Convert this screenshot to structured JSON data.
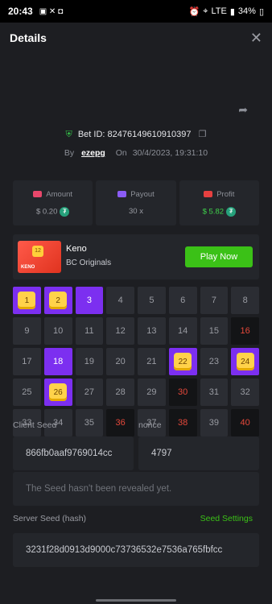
{
  "status_bar": {
    "time": "20:43",
    "signal": "LTE",
    "battery": "34%"
  },
  "header": {
    "title": "Details",
    "close": "✕"
  },
  "bet": {
    "id_label": "Bet ID:",
    "id": "82476149610910397",
    "by_label": "By",
    "user": "ezepg",
    "on_label": "On",
    "date": "30/4/2023, 19:31:10"
  },
  "stats": {
    "amount": {
      "label": "Amount",
      "value": "$ 0.20"
    },
    "payout": {
      "label": "Payout",
      "value": "30 x"
    },
    "profit": {
      "label": "Profit",
      "value": "$ 5.82"
    }
  },
  "game": {
    "name": "Keno",
    "provider": "BC Originals",
    "play_label": "Play Now",
    "thumb_caption": "KENO",
    "thumb_mini": "12"
  },
  "board": {
    "rows": [
      [
        {
          "n": "1",
          "s": "hit"
        },
        {
          "n": "2",
          "s": "hit"
        },
        {
          "n": "3",
          "s": "pick"
        },
        {
          "n": "4",
          "s": ""
        },
        {
          "n": "5",
          "s": ""
        },
        {
          "n": "6",
          "s": ""
        },
        {
          "n": "7",
          "s": ""
        },
        {
          "n": "8",
          "s": ""
        }
      ],
      [
        {
          "n": "9",
          "s": ""
        },
        {
          "n": "10",
          "s": ""
        },
        {
          "n": "11",
          "s": ""
        },
        {
          "n": "12",
          "s": ""
        },
        {
          "n": "13",
          "s": ""
        },
        {
          "n": "14",
          "s": ""
        },
        {
          "n": "15",
          "s": ""
        },
        {
          "n": "16",
          "s": "drawn"
        }
      ],
      [
        {
          "n": "17",
          "s": ""
        },
        {
          "n": "18",
          "s": "pick"
        },
        {
          "n": "19",
          "s": ""
        },
        {
          "n": "20",
          "s": ""
        },
        {
          "n": "21",
          "s": ""
        },
        {
          "n": "22",
          "s": "hit"
        },
        {
          "n": "23",
          "s": ""
        },
        {
          "n": "24",
          "s": "hit"
        }
      ],
      [
        {
          "n": "25",
          "s": ""
        },
        {
          "n": "26",
          "s": "hit"
        },
        {
          "n": "27",
          "s": ""
        },
        {
          "n": "28",
          "s": ""
        },
        {
          "n": "29",
          "s": ""
        },
        {
          "n": "30",
          "s": "drawn"
        },
        {
          "n": "31",
          "s": ""
        },
        {
          "n": "32",
          "s": ""
        }
      ],
      [
        {
          "n": "33",
          "s": ""
        },
        {
          "n": "34",
          "s": ""
        },
        {
          "n": "35",
          "s": ""
        },
        {
          "n": "36",
          "s": "drawn"
        },
        {
          "n": "37",
          "s": ""
        },
        {
          "n": "38",
          "s": "drawn"
        },
        {
          "n": "39",
          "s": ""
        },
        {
          "n": "40",
          "s": "drawn"
        }
      ]
    ]
  },
  "server_seed": {
    "label": "Server Seed",
    "value": "The Seed hasn't been revealed yet."
  },
  "server_seed_hash": {
    "label": "Server Seed (hash)",
    "settings_label": "Seed Settings",
    "value": "3231f28d0913d9000c73736532e7536a765fbfcc"
  },
  "client_seed": {
    "label": "Client Seed",
    "value": "866fb0aaf9769014cc"
  },
  "nonce": {
    "label": "nonce",
    "value": "4797"
  },
  "colors": {
    "accent": "#7c2ff0",
    "win": "#ffd24a",
    "play": "#3bc117",
    "loss": "#e5483a"
  }
}
